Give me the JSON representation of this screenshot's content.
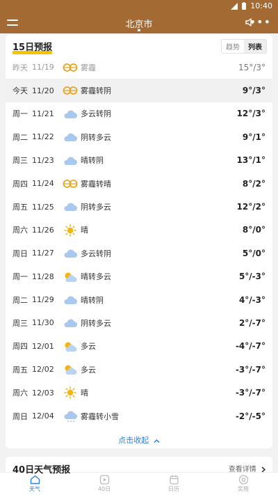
{
  "status": {
    "time": "10:40"
  },
  "header": {
    "city": "北京市"
  },
  "forecast15": {
    "title": "15日预报",
    "toggle": {
      "trend": "趋势",
      "list": "列表"
    },
    "rows": [
      {
        "day": "昨天",
        "date": "11/19",
        "icon": "haze-icon",
        "desc": "雾霾",
        "temp": "15°/3°",
        "past": true
      },
      {
        "day": "今天",
        "date": "11/20",
        "icon": "haze-icon",
        "desc": "雾霾转阴",
        "temp": "9°/3°",
        "today": true
      },
      {
        "day": "周一",
        "date": "11/21",
        "icon": "cloud-icon",
        "desc": "多云转阴",
        "temp": "12°/3°"
      },
      {
        "day": "周二",
        "date": "11/22",
        "icon": "cloud-icon",
        "desc": "阴转多云",
        "temp": "9°/1°"
      },
      {
        "day": "周三",
        "date": "11/23",
        "icon": "cloud-icon",
        "desc": "晴转阴",
        "temp": "13°/1°"
      },
      {
        "day": "周四",
        "date": "11/24",
        "icon": "haze-icon",
        "desc": "雾霾转晴",
        "temp": "8°/2°"
      },
      {
        "day": "周五",
        "date": "11/25",
        "icon": "cloud-icon",
        "desc": "阴转多云",
        "temp": "12°/2°"
      },
      {
        "day": "周六",
        "date": "11/26",
        "icon": "sun-icon",
        "desc": "晴",
        "temp": "8°/0°"
      },
      {
        "day": "周日",
        "date": "11/27",
        "icon": "cloud-icon",
        "desc": "多云转阴",
        "temp": "5°/0°"
      },
      {
        "day": "周一",
        "date": "11/28",
        "icon": "partly-cloudy-icon",
        "desc": "晴转多云",
        "temp": "5°/-3°"
      },
      {
        "day": "周二",
        "date": "11/29",
        "icon": "cloud-icon",
        "desc": "晴转阴",
        "temp": "4°/-3°"
      },
      {
        "day": "周三",
        "date": "11/30",
        "icon": "cloud-icon",
        "desc": "阴转多云",
        "temp": "2°/-7°"
      },
      {
        "day": "周四",
        "date": "12/01",
        "icon": "partly-cloudy-icon",
        "desc": "多云",
        "temp": "-4°/-7°"
      },
      {
        "day": "周五",
        "date": "12/02",
        "icon": "partly-cloudy-icon",
        "desc": "多云",
        "temp": "-3°/-7°"
      },
      {
        "day": "周六",
        "date": "12/03",
        "icon": "sun-icon",
        "desc": "晴",
        "temp": "-3°/-7°"
      },
      {
        "day": "周日",
        "date": "12/04",
        "icon": "snow-cloud-icon",
        "desc": "雾霾转小雪",
        "temp": "-2°/-5°"
      }
    ],
    "collapse_label": "点击收起"
  },
  "forecast40": {
    "title": "40日天气预报",
    "detail_label": "查看详情"
  },
  "tabs": [
    {
      "label": "天气",
      "icon": "home-icon",
      "active": true
    },
    {
      "label": "40日",
      "icon": "play-icon"
    },
    {
      "label": "日历",
      "icon": "calendar-icon"
    },
    {
      "label": "实用",
      "icon": "target-icon"
    }
  ],
  "colors": {
    "brand": "#a46a33",
    "accent": "#2f7de1",
    "highlight": "#f5c400"
  }
}
